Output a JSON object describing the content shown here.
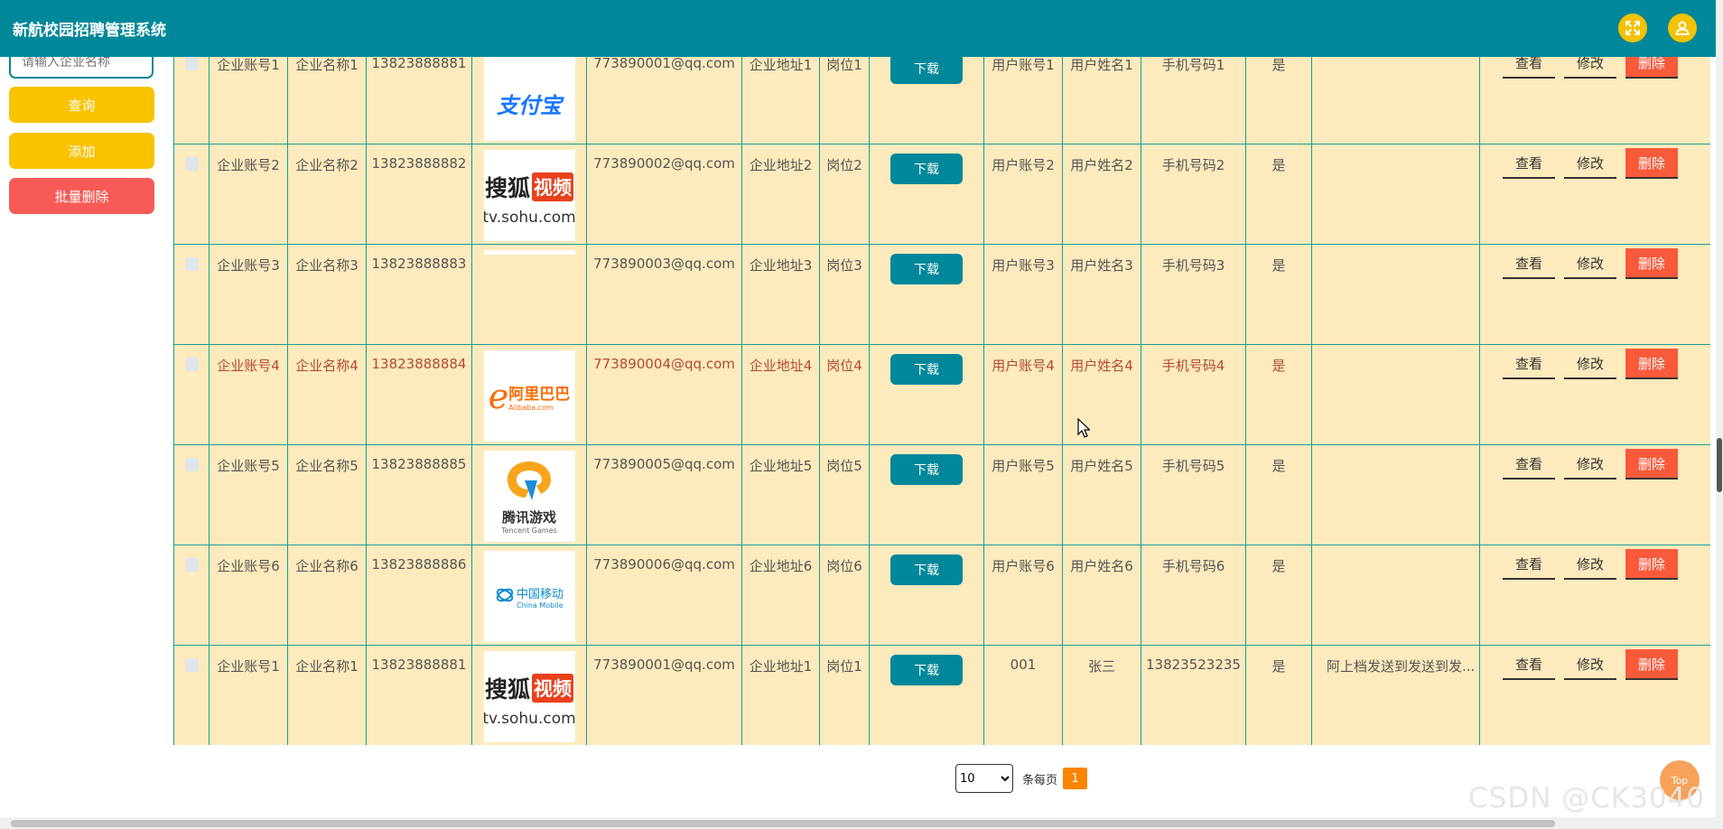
{
  "app": {
    "title": "新航校园招聘管理系统",
    "header_icons": [
      "fullscreen-icon",
      "user-icon"
    ]
  },
  "sidebar": {
    "search_placeholder": "请输入企业名称",
    "query_label": "查询",
    "add_label": "添加",
    "batch_delete_label": "批量删除"
  },
  "colors": {
    "header": "#00879a",
    "table_bg": "#fdeabd",
    "border": "#199e93",
    "yellow": "#f9c300",
    "red": "#f85a55",
    "highlight_text": "#b14a35"
  },
  "table": {
    "download_label": "下载",
    "actions": {
      "view": "查看",
      "edit": "修改",
      "delete": "删除"
    },
    "rows": [
      {
        "account": "企业账号1",
        "name": "企业名称1",
        "phone": "13823888881",
        "logo": "alipay-logo",
        "logo_text": "支付宝",
        "email": "773890001@qq.com",
        "address": "企业地址1",
        "position": "岗位1",
        "user_account": "用户账号1",
        "user_name": "用户姓名1",
        "user_phone": "手机号码1",
        "flag": "是",
        "note": ""
      },
      {
        "account": "企业账号2",
        "name": "企业名称2",
        "phone": "13823888882",
        "logo": "sohu-video-logo",
        "logo_text": "搜狐",
        "logo_text2": "视频",
        "logo_url": "tv.sohu.com",
        "email": "773890002@qq.com",
        "address": "企业地址2",
        "position": "岗位2",
        "user_account": "用户账号2",
        "user_name": "用户姓名2",
        "user_phone": "手机号码2",
        "flag": "是",
        "note": ""
      },
      {
        "account": "企业账号3",
        "name": "企业名称3",
        "phone": "13823888883",
        "logo": "blank-logo",
        "email": "773890003@qq.com",
        "address": "企业地址3",
        "position": "岗位3",
        "user_account": "用户账号3",
        "user_name": "用户姓名3",
        "user_phone": "手机号码3",
        "flag": "是",
        "note": ""
      },
      {
        "account": "企业账号4",
        "name": "企业名称4",
        "phone": "13823888884",
        "logo": "alibaba-logo",
        "logo_text": "阿里巴巴",
        "logo_sub": "Alibaba.com",
        "email": "773890004@qq.com",
        "address": "企业地址4",
        "position": "岗位4",
        "user_account": "用户账号4",
        "user_name": "用户姓名4",
        "user_phone": "手机号码4",
        "flag": "是",
        "note": "",
        "highlighted": true
      },
      {
        "account": "企业账号5",
        "name": "企业名称5",
        "phone": "13823888885",
        "logo": "tencent-games-logo",
        "logo_text": "腾讯游戏",
        "logo_sub": "Tencent Games",
        "email": "773890005@qq.com",
        "address": "企业地址5",
        "position": "岗位5",
        "user_account": "用户账号5",
        "user_name": "用户姓名5",
        "user_phone": "手机号码5",
        "flag": "是",
        "note": ""
      },
      {
        "account": "企业账号6",
        "name": "企业名称6",
        "phone": "13823888886",
        "logo": "china-mobile-logo",
        "logo_text": "中国移动",
        "logo_sub": "China Mobile",
        "email": "773890006@qq.com",
        "address": "企业地址6",
        "position": "岗位6",
        "user_account": "用户账号6",
        "user_name": "用户姓名6",
        "user_phone": "手机号码6",
        "flag": "是",
        "note": ""
      },
      {
        "account": "企业账号1",
        "name": "企业名称1",
        "phone": "13823888881",
        "logo": "sohu-video-logo",
        "logo_text": "搜狐",
        "logo_text2": "视频",
        "logo_url": "tv.sohu.com",
        "email": "773890001@qq.com",
        "address": "企业地址1",
        "position": "岗位1",
        "user_account": "001",
        "user_name": "张三",
        "user_phone": "13823523235",
        "flag": "是",
        "note": "阿上档发送到发送到发..."
      }
    ]
  },
  "pagination": {
    "page_size": "10",
    "page_size_options": [
      "10"
    ],
    "per_page_label": "条每页",
    "current_page": "1"
  },
  "back_to_top_label": "Top",
  "watermark": "CSDN @CK3040"
}
